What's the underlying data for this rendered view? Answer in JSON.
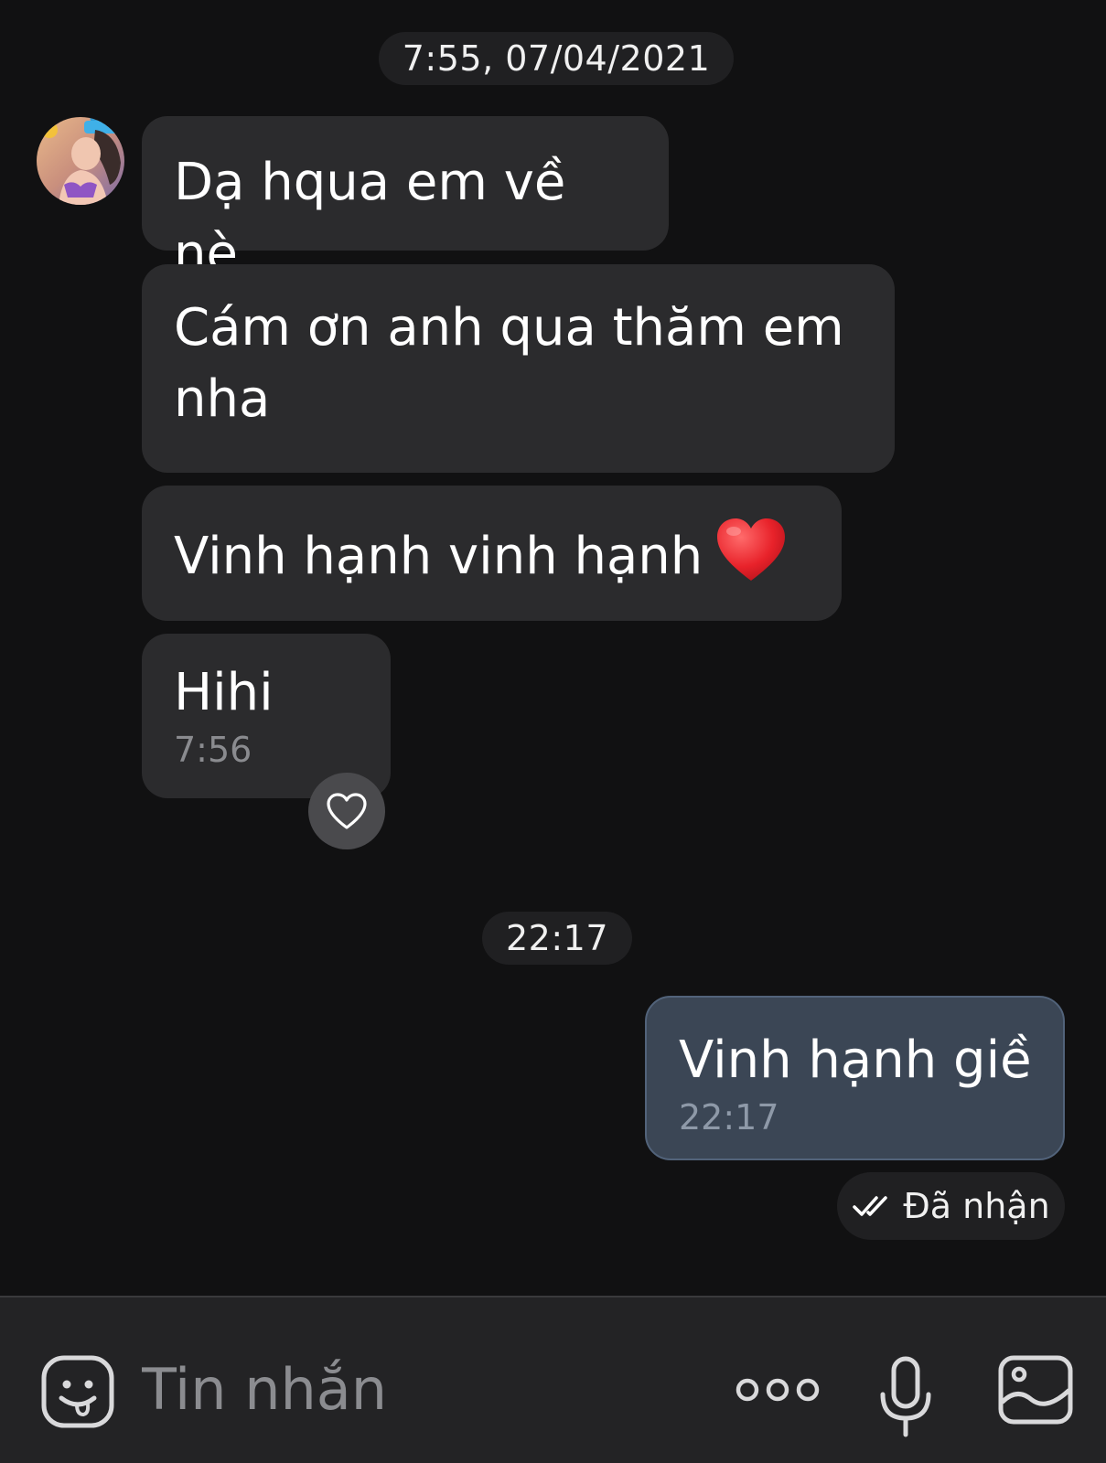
{
  "timeline": {
    "separator_1": "7:55, 07/04/2021",
    "separator_2": "22:17"
  },
  "incoming": [
    {
      "text": "Dạ hqua em về nè"
    },
    {
      "text": "Cám ơn anh qua thăm em nha"
    },
    {
      "text": "Vinh hạnh vinh hạnh",
      "emoji": "red-heart-emoji"
    },
    {
      "text": "Hihi",
      "time": "7:56"
    }
  ],
  "outgoing": [
    {
      "text": "Vinh hạnh giề",
      "time": "22:17",
      "status": "Đã nhận",
      "status_icon": "double-check-icon"
    }
  ],
  "reaction": {
    "icon": "heart-outline-icon"
  },
  "composer": {
    "placeholder": "Tin nhắn",
    "value": "",
    "icons": [
      "emoji-icon",
      "more-icon",
      "microphone-icon",
      "image-icon"
    ]
  },
  "colors": {
    "background": "#111112",
    "incoming_bubble": "#2b2b2d",
    "outgoing_bubble": "#3b4655",
    "composer_bar": "#232325"
  }
}
